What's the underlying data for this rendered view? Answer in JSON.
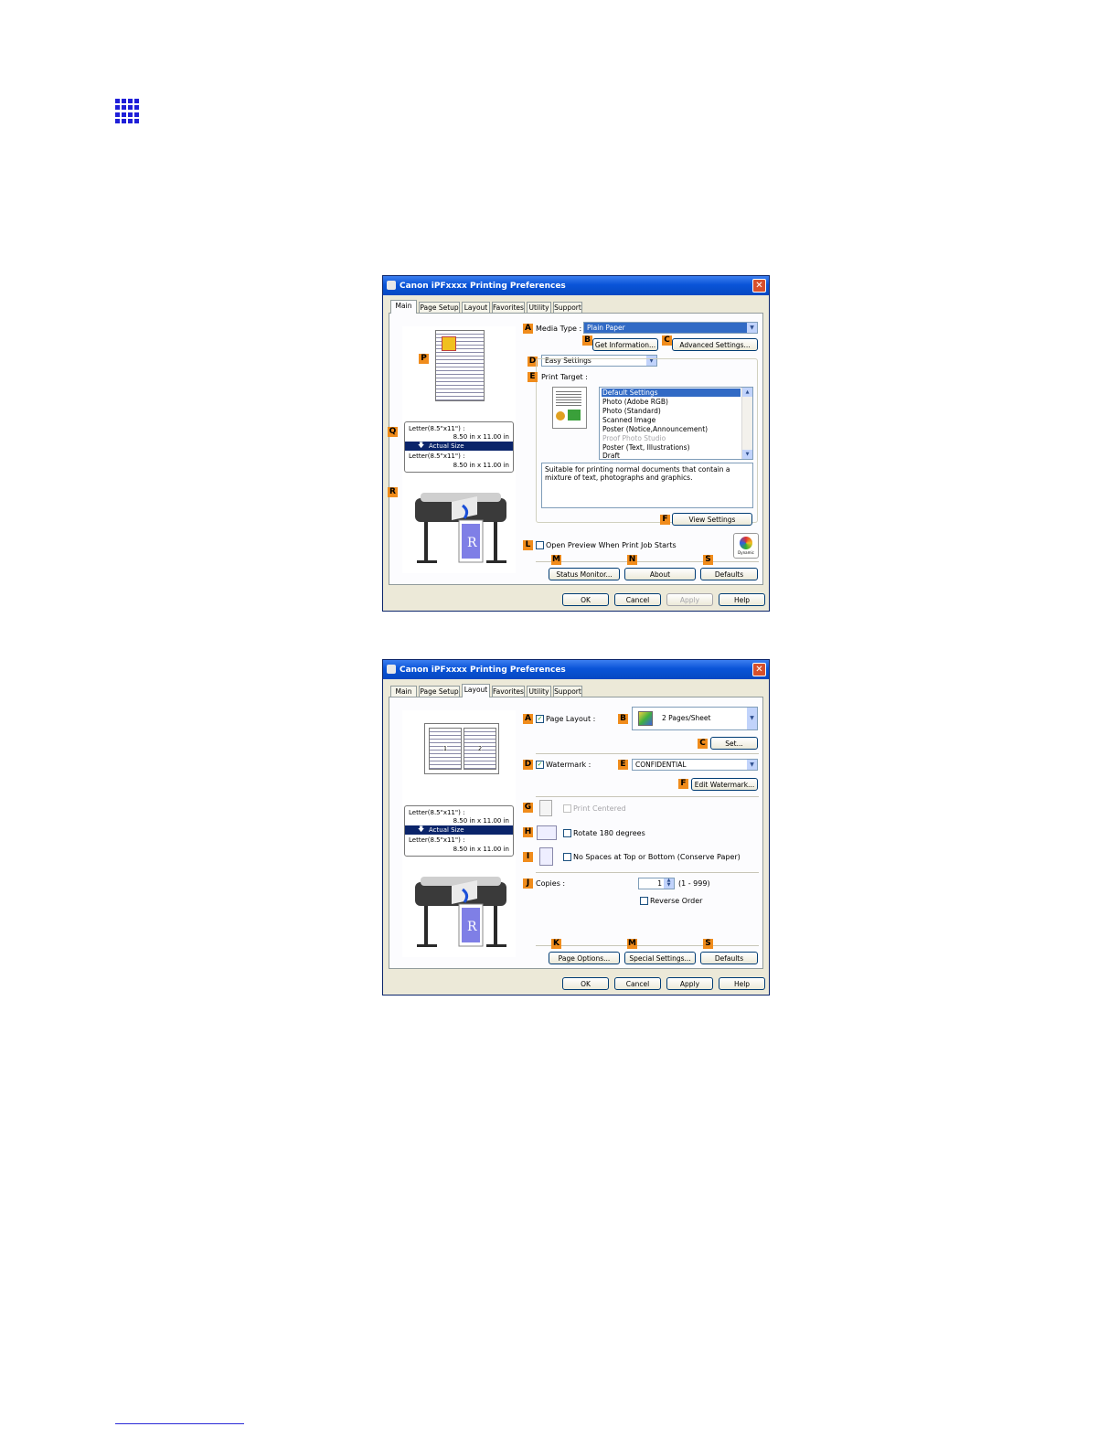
{
  "dialog1": {
    "title": "Canon iPFxxxx Printing Preferences",
    "close": "✕",
    "tabs": [
      "Main",
      "Page Setup",
      "Layout",
      "Favorites",
      "Utility",
      "Support"
    ],
    "active_tab": "Main",
    "badges": {
      "A": "A",
      "B": "B",
      "C": "C",
      "D": "D",
      "E": "E",
      "F": "F",
      "L": "L",
      "M": "M",
      "N": "N",
      "S": "S",
      "P": "P",
      "Q": "Q",
      "R": "R"
    },
    "media_type_label": "Media Type :",
    "media_type_value": "Plain Paper",
    "get_information": "Get Information...",
    "advanced_settings": "Advanced Settings...",
    "settings_mode": "Easy Settings",
    "print_target_label": "Print Target :",
    "print_target_items": [
      "Default Settings",
      "Photo (Adobe RGB)",
      "Photo (Standard)",
      "Scanned Image",
      "Poster (Notice,Announcement)",
      "Proof Photo Studio",
      "Poster (Text, Illustrations)",
      "Draft"
    ],
    "description": "Suitable for printing normal documents that contain a mixture of text, photographs and graphics.",
    "view_settings": "View Settings",
    "open_preview": "Open Preview When Print Job Starts",
    "dynamic": "Dynamic",
    "status_monitor": "Status Monitor...",
    "about": "About",
    "defaults": "Defaults",
    "ok": "OK",
    "cancel": "Cancel",
    "apply": "Apply",
    "help": "Help",
    "size_line1": "Letter(8.5\"x11\") :",
    "size_line2": "8.50 in x 11.00 in",
    "size_bar": "Actual Size",
    "size_line3": "Letter(8.5\"x11\") :",
    "size_line4": "8.50 in x 11.00 in",
    "arrow": "🡇"
  },
  "dialog2": {
    "title": "Canon iPFxxxx Printing Preferences",
    "close": "✕",
    "tabs": [
      "Main",
      "Page Setup",
      "Layout",
      "Favorites",
      "Utility",
      "Support"
    ],
    "active_tab": "Layout",
    "badges": {
      "A": "A",
      "B": "B",
      "C": "C",
      "D": "D",
      "E": "E",
      "F": "F",
      "G": "G",
      "H": "H",
      "I": "I",
      "J": "J",
      "K": "K",
      "M": "M",
      "S": "S"
    },
    "page_layout_label": "Page Layout :",
    "page_layout_value": "2 Pages/Sheet",
    "set": "Set...",
    "watermark_label": "Watermark :",
    "watermark_value": "CONFIDENTIAL",
    "edit_watermark": "Edit Watermark...",
    "print_centered": "Print Centered",
    "rotate": "Rotate 180 degrees",
    "no_spaces": "No Spaces at Top or Bottom (Conserve Paper)",
    "copies_label": "Copies :",
    "copies_value": "1",
    "copies_range": "(1 - 999)",
    "reverse_order": "Reverse Order",
    "page_options": "Page Options...",
    "special_settings": "Special Settings...",
    "defaults": "Defaults",
    "ok": "OK",
    "cancel": "Cancel",
    "apply": "Apply",
    "help": "Help",
    "thumb_num1": "1",
    "thumb_num2": "2",
    "size_line1": "Letter(8.5\"x11\") :",
    "size_line2": "8.50 in x 11.00 in",
    "size_bar": "Actual Size",
    "size_line3": "Letter(8.5\"x11\") :",
    "size_line4": "8.50 in x 11.00 in",
    "arrow": "🡇"
  },
  "colors": {
    "accent": "#0a54d8",
    "badge": "#f08c1c",
    "selection": "#316ac5",
    "dialog_bg": "#ece9d8"
  }
}
